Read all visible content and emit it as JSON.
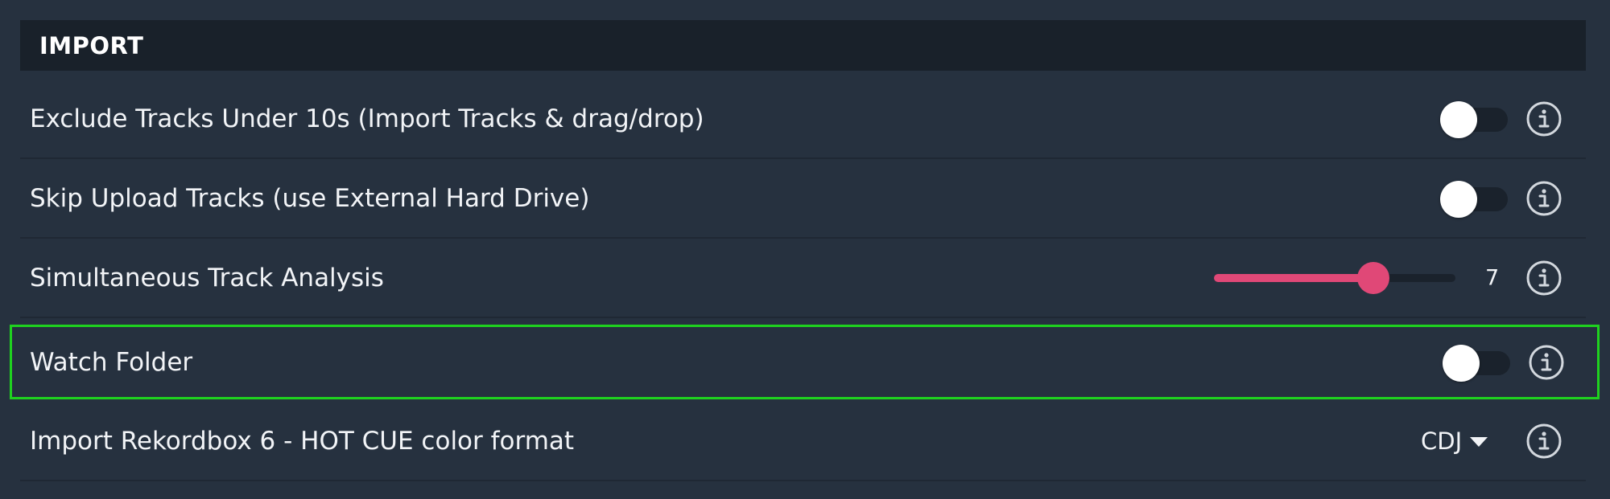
{
  "section": {
    "title": "IMPORT"
  },
  "rows": [
    {
      "label": "Exclude Tracks Under 10s (Import Tracks & drag/drop)",
      "control": "toggle",
      "enabled": false
    },
    {
      "label": "Skip Upload Tracks (use External Hard Drive)",
      "control": "toggle",
      "enabled": false
    },
    {
      "label": "Simultaneous Track Analysis",
      "control": "slider",
      "value": "7",
      "fraction": 0.66
    },
    {
      "label": "Watch Folder",
      "control": "toggle",
      "enabled": false,
      "highlighted": true
    },
    {
      "label": "Import Rekordbox 6 - HOT CUE color format",
      "control": "dropdown",
      "value": "CDJ"
    }
  ],
  "icons": {
    "info": "info-circle-icon",
    "caret": "caret-down-icon"
  },
  "colors": {
    "background": "#26313f",
    "header_bg": "#19212a",
    "accent": "#e04877",
    "highlight": "#1fd21f",
    "toggle_track": "#1a222c",
    "toggle_knob": "#ffffff"
  }
}
